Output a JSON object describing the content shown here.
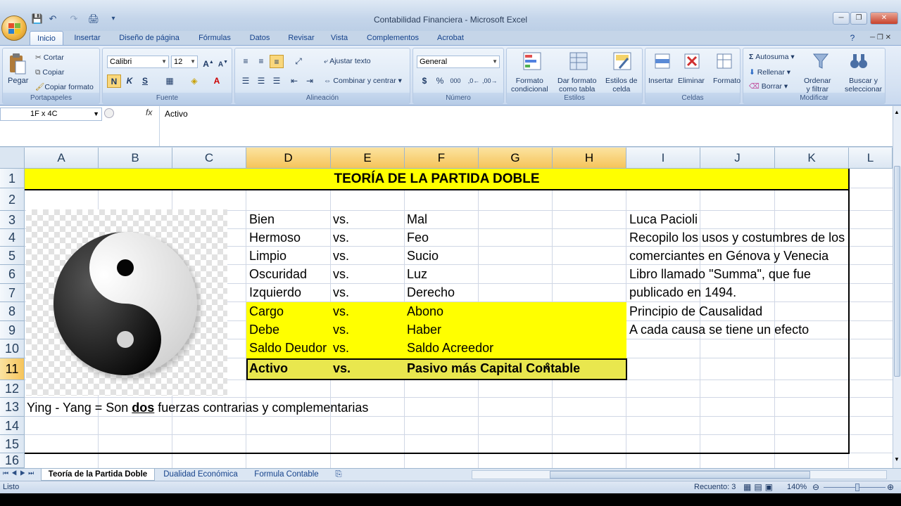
{
  "window": {
    "title": "Contabilidad Financiera - Microsoft Excel",
    "controls": [
      "─",
      "❐",
      "✕"
    ]
  },
  "qat": {
    "save": "💾",
    "undo": "↶",
    "redo": "↷",
    "print": "🖨",
    "more": "▾"
  },
  "tabs": [
    "Inicio",
    "Insertar",
    "Diseño de página",
    "Fórmulas",
    "Datos",
    "Revisar",
    "Vista",
    "Complementos",
    "Acrobat"
  ],
  "ribbon": {
    "clipboard": {
      "paste": "Pegar",
      "cut": "Cortar",
      "copy": "Copiar",
      "format_painter": "Copiar formato",
      "label": "Portapapeles"
    },
    "font": {
      "name": "Calibri",
      "size": "12",
      "bold": "N",
      "italic": "K",
      "underline": "S",
      "label": "Fuente"
    },
    "alignment": {
      "wrap": "Ajustar texto",
      "merge": "Combinar y centrar",
      "label": "Alineación"
    },
    "number": {
      "format": "General",
      "currency": "$",
      "percent": "%",
      "thousands": "000",
      "label": "Número"
    },
    "styles": {
      "conditional": "Formato\ncondicional",
      "as_table": "Dar formato\ncomo tabla",
      "cell_styles": "Estilos de\ncelda",
      "label": "Estilos"
    },
    "cells": {
      "insert": "Insertar",
      "delete": "Eliminar",
      "format": "Formato",
      "label": "Celdas"
    },
    "editing": {
      "autosum": "Autosuma",
      "fill": "Rellenar",
      "clear": "Borrar",
      "sort": "Ordenar\ny filtrar",
      "find": "Buscar y\nseleccionar",
      "label": "Modificar"
    }
  },
  "formula_bar": {
    "name_box": "1F x 4C",
    "fx": "fx",
    "content": "Activo"
  },
  "columns": [
    "A",
    "B",
    "C",
    "D",
    "E",
    "F",
    "G",
    "H",
    "I",
    "J",
    "K",
    "L"
  ],
  "rows": [
    "1",
    "2",
    "3",
    "4",
    "5",
    "6",
    "7",
    "8",
    "9",
    "10",
    "11",
    "12",
    "13",
    "14",
    "15",
    "16"
  ],
  "cells": {
    "title": "TEORÍA DE LA PARTIDA DOBLE",
    "pairs": [
      {
        "left": "Bien",
        "vs": "vs.",
        "right": "Mal"
      },
      {
        "left": "Hermoso",
        "vs": "vs.",
        "right": "Feo"
      },
      {
        "left": "Limpio",
        "vs": "vs.",
        "right": "Sucio"
      },
      {
        "left": "Oscuridad",
        "vs": "vs.",
        "right": "Luz"
      },
      {
        "left": "Izquierdo",
        "vs": "vs.",
        "right": "Derecho"
      },
      {
        "left": "Cargo",
        "vs": "vs.",
        "right": "Abono"
      },
      {
        "left": "Debe",
        "vs": "vs.",
        "right": "Haber"
      },
      {
        "left": "Saldo Deudor",
        "vs": "vs.",
        "right": "Saldo Acreedor"
      },
      {
        "left": "Activo",
        "vs": "vs.",
        "right": "Pasivo más Capital Contable"
      }
    ],
    "notes": [
      "Luca Pacioli",
      "Recopilo los usos y costumbres de los",
      "comerciantes en Génova y Venecia",
      "Libro llamado \"Summa\", que fue",
      "publicado en 1494.",
      "Principio de Causalidad",
      "A cada causa se tiene un efecto"
    ],
    "row13_a": "Ying - Yang = Son ",
    "row13_b": "dos",
    "row13_c": " fuerzas contrarias y complementarias"
  },
  "sheets": [
    "Teoría de la Partida Doble",
    "Dualidad Económica",
    "Formula Contable"
  ],
  "status": {
    "ready": "Listo",
    "count": "Recuento: 3",
    "zoom": "140%"
  },
  "colors": {
    "highlight": "#ffff00",
    "header_selected": "#f6c45a",
    "grid": "#d0d7e5"
  }
}
